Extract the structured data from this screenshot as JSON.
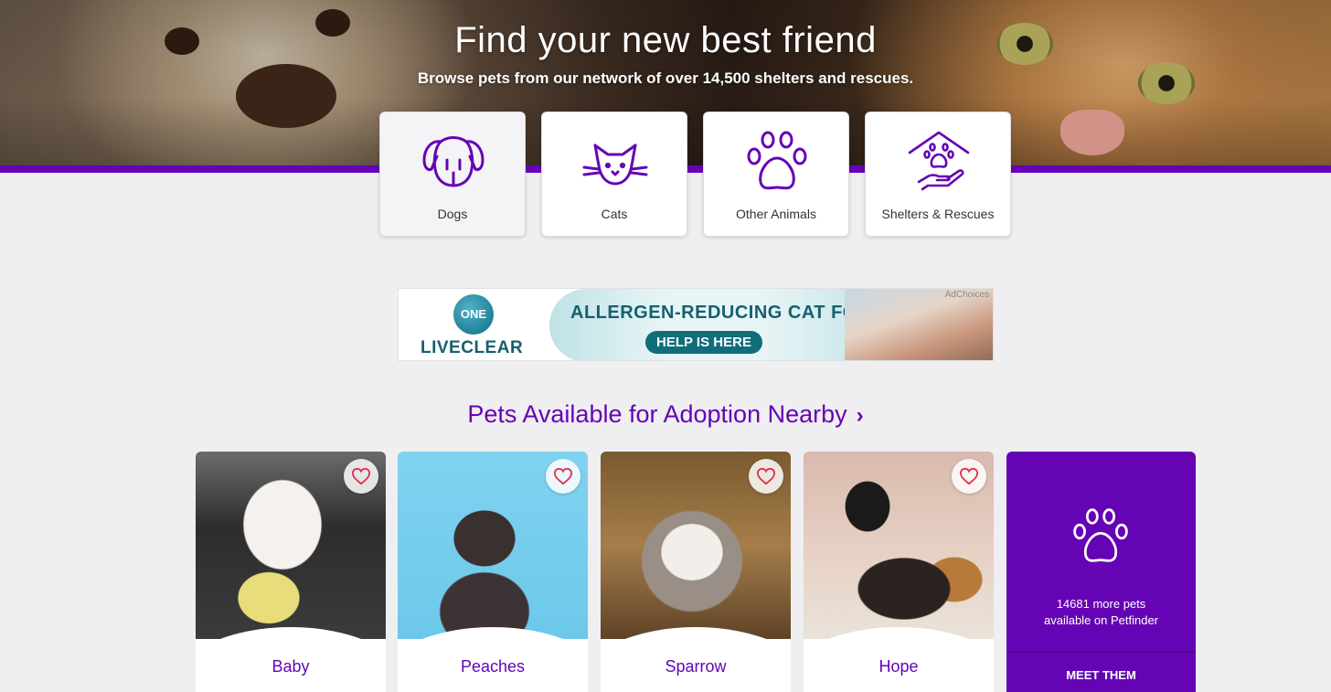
{
  "hero": {
    "title": "Find your new best friend",
    "subtitle": "Browse pets from our network of over 14,500 shelters and rescues."
  },
  "categories": [
    {
      "label": "Dogs",
      "icon": "dog-icon"
    },
    {
      "label": "Cats",
      "icon": "cat-icon"
    },
    {
      "label": "Other Animals",
      "icon": "paw-icon"
    },
    {
      "label": "Shelters & Rescues",
      "icon": "shelter-icon"
    }
  ],
  "ad": {
    "logo_text": "ONE",
    "brand": "LIVECLEAR",
    "headline": "ALLERGEN-REDUCING CAT FOOD",
    "button": "HELP IS HERE",
    "choices": "AdChoices"
  },
  "section": {
    "title": "Pets Available for Adoption Nearby",
    "chevron": "›"
  },
  "pets": [
    {
      "name": "Baby"
    },
    {
      "name": "Peaches"
    },
    {
      "name": "Sparrow"
    },
    {
      "name": "Hope"
    }
  ],
  "more": {
    "line1": "14681 more pets",
    "line2": "available on Petfinder",
    "button": "MEET THEM"
  },
  "colors": {
    "brand_purple": "#6504b5",
    "heart_red": "#e0304a"
  }
}
